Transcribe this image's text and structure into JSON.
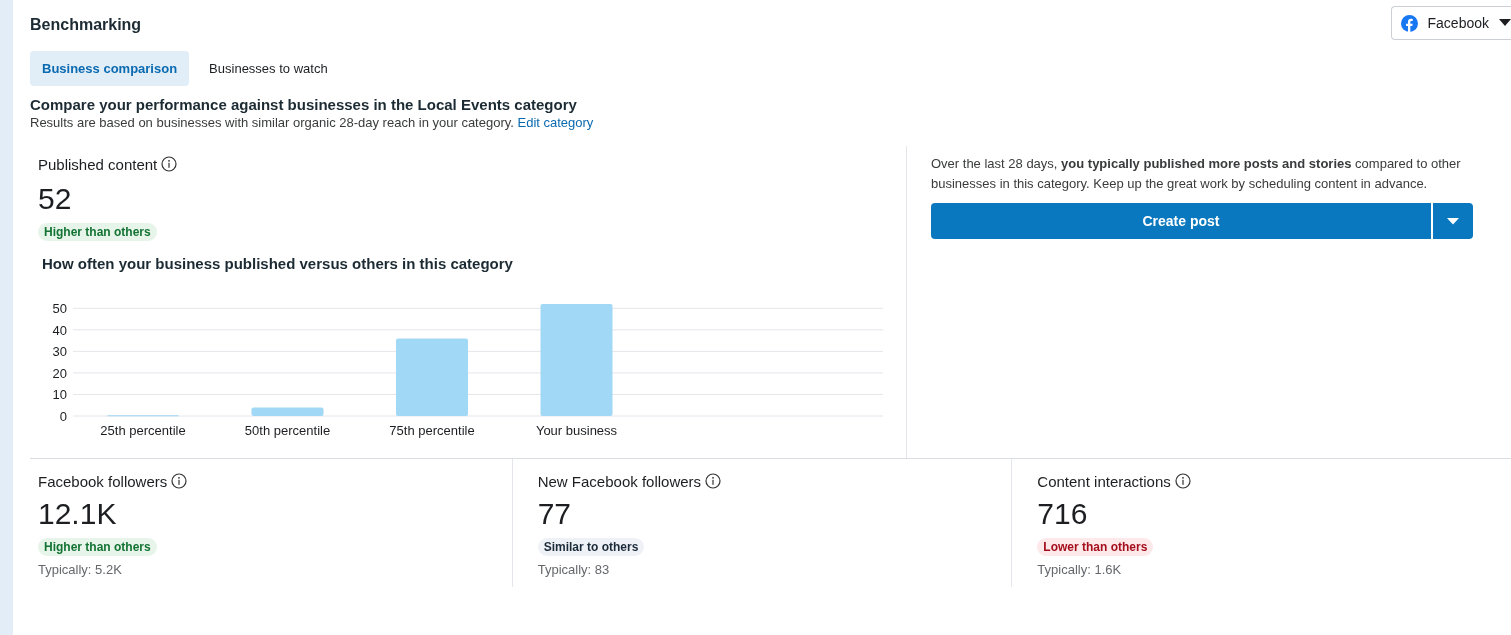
{
  "header": {
    "title": "Benchmarking",
    "platform_selector": "Facebook"
  },
  "tabs": [
    {
      "label": "Business comparison",
      "selected": true
    },
    {
      "label": "Businesses to watch",
      "selected": false
    }
  ],
  "intro": {
    "heading": "Compare your performance against businesses in the Local Events category",
    "text": "Results are based on businesses with similar organic 28-day reach in your category.",
    "link": "Edit category"
  },
  "published": {
    "label": "Published content",
    "value": "52",
    "status": {
      "kind": "higher",
      "text": "Higher than others"
    },
    "chart_title": "How often your business published versus others in this category",
    "chart_data": {
      "type": "bar",
      "categories": [
        "25th percentile",
        "50th percentile",
        "75th percentile",
        "Your business"
      ],
      "values": [
        0.3,
        4,
        36,
        52
      ],
      "ylim": [
        0,
        52
      ],
      "grid": true,
      "yticks": [
        0,
        10,
        20,
        30,
        40,
        50
      ]
    }
  },
  "insight": {
    "text": "Over the last 28 days, **you typically published more posts and stories** compared to other businesses in this category. Keep up the great work by scheduling content in advance.",
    "button": "Create post"
  },
  "stats": [
    {
      "label": "Facebook followers",
      "value": "12.1K",
      "status": {
        "kind": "higher",
        "text": "Higher than others"
      },
      "typical": "Typically: 5.2K"
    },
    {
      "label": "New Facebook followers",
      "value": "77",
      "status": {
        "kind": "similar",
        "text": "Similar to others"
      },
      "typical": "Typically: 83"
    },
    {
      "label": "Content interactions",
      "value": "716",
      "status": {
        "kind": "lower",
        "text": "Lower than others"
      },
      "typical": "Typically: 1.6K"
    }
  ]
}
